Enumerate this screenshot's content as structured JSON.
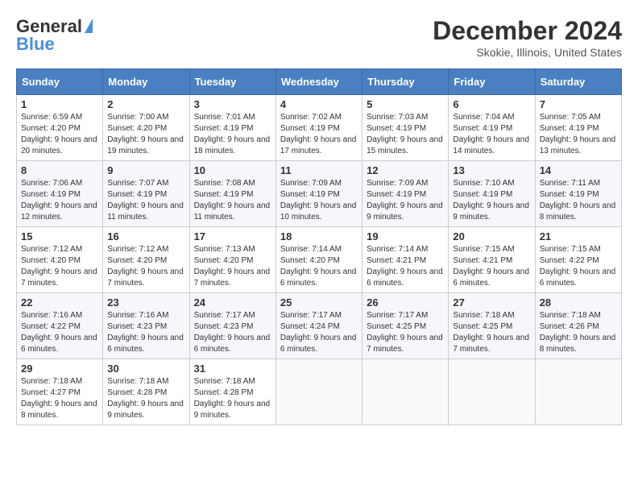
{
  "header": {
    "logo_general": "General",
    "logo_blue": "Blue",
    "month_title": "December 2024",
    "subtitle": "Skokie, Illinois, United States"
  },
  "days_of_week": [
    "Sunday",
    "Monday",
    "Tuesday",
    "Wednesday",
    "Thursday",
    "Friday",
    "Saturday"
  ],
  "weeks": [
    [
      {
        "day": "1",
        "sunrise": "6:59 AM",
        "sunset": "4:20 PM",
        "daylight": "9 hours and 20 minutes."
      },
      {
        "day": "2",
        "sunrise": "7:00 AM",
        "sunset": "4:20 PM",
        "daylight": "9 hours and 19 minutes."
      },
      {
        "day": "3",
        "sunrise": "7:01 AM",
        "sunset": "4:19 PM",
        "daylight": "9 hours and 18 minutes."
      },
      {
        "day": "4",
        "sunrise": "7:02 AM",
        "sunset": "4:19 PM",
        "daylight": "9 hours and 17 minutes."
      },
      {
        "day": "5",
        "sunrise": "7:03 AM",
        "sunset": "4:19 PM",
        "daylight": "9 hours and 15 minutes."
      },
      {
        "day": "6",
        "sunrise": "7:04 AM",
        "sunset": "4:19 PM",
        "daylight": "9 hours and 14 minutes."
      },
      {
        "day": "7",
        "sunrise": "7:05 AM",
        "sunset": "4:19 PM",
        "daylight": "9 hours and 13 minutes."
      }
    ],
    [
      {
        "day": "8",
        "sunrise": "7:06 AM",
        "sunset": "4:19 PM",
        "daylight": "9 hours and 12 minutes."
      },
      {
        "day": "9",
        "sunrise": "7:07 AM",
        "sunset": "4:19 PM",
        "daylight": "9 hours and 11 minutes."
      },
      {
        "day": "10",
        "sunrise": "7:08 AM",
        "sunset": "4:19 PM",
        "daylight": "9 hours and 11 minutes."
      },
      {
        "day": "11",
        "sunrise": "7:09 AM",
        "sunset": "4:19 PM",
        "daylight": "9 hours and 10 minutes."
      },
      {
        "day": "12",
        "sunrise": "7:09 AM",
        "sunset": "4:19 PM",
        "daylight": "9 hours and 9 minutes."
      },
      {
        "day": "13",
        "sunrise": "7:10 AM",
        "sunset": "4:19 PM",
        "daylight": "9 hours and 9 minutes."
      },
      {
        "day": "14",
        "sunrise": "7:11 AM",
        "sunset": "4:19 PM",
        "daylight": "9 hours and 8 minutes."
      }
    ],
    [
      {
        "day": "15",
        "sunrise": "7:12 AM",
        "sunset": "4:20 PM",
        "daylight": "9 hours and 7 minutes."
      },
      {
        "day": "16",
        "sunrise": "7:12 AM",
        "sunset": "4:20 PM",
        "daylight": "9 hours and 7 minutes."
      },
      {
        "day": "17",
        "sunrise": "7:13 AM",
        "sunset": "4:20 PM",
        "daylight": "9 hours and 7 minutes."
      },
      {
        "day": "18",
        "sunrise": "7:14 AM",
        "sunset": "4:20 PM",
        "daylight": "9 hours and 6 minutes."
      },
      {
        "day": "19",
        "sunrise": "7:14 AM",
        "sunset": "4:21 PM",
        "daylight": "9 hours and 6 minutes."
      },
      {
        "day": "20",
        "sunrise": "7:15 AM",
        "sunset": "4:21 PM",
        "daylight": "9 hours and 6 minutes."
      },
      {
        "day": "21",
        "sunrise": "7:15 AM",
        "sunset": "4:22 PM",
        "daylight": "9 hours and 6 minutes."
      }
    ],
    [
      {
        "day": "22",
        "sunrise": "7:16 AM",
        "sunset": "4:22 PM",
        "daylight": "9 hours and 6 minutes."
      },
      {
        "day": "23",
        "sunrise": "7:16 AM",
        "sunset": "4:23 PM",
        "daylight": "9 hours and 6 minutes."
      },
      {
        "day": "24",
        "sunrise": "7:17 AM",
        "sunset": "4:23 PM",
        "daylight": "9 hours and 6 minutes."
      },
      {
        "day": "25",
        "sunrise": "7:17 AM",
        "sunset": "4:24 PM",
        "daylight": "9 hours and 6 minutes."
      },
      {
        "day": "26",
        "sunrise": "7:17 AM",
        "sunset": "4:25 PM",
        "daylight": "9 hours and 7 minutes."
      },
      {
        "day": "27",
        "sunrise": "7:18 AM",
        "sunset": "4:25 PM",
        "daylight": "9 hours and 7 minutes."
      },
      {
        "day": "28",
        "sunrise": "7:18 AM",
        "sunset": "4:26 PM",
        "daylight": "9 hours and 8 minutes."
      }
    ],
    [
      {
        "day": "29",
        "sunrise": "7:18 AM",
        "sunset": "4:27 PM",
        "daylight": "9 hours and 8 minutes."
      },
      {
        "day": "30",
        "sunrise": "7:18 AM",
        "sunset": "4:28 PM",
        "daylight": "9 hours and 9 minutes."
      },
      {
        "day": "31",
        "sunrise": "7:18 AM",
        "sunset": "4:28 PM",
        "daylight": "9 hours and 9 minutes."
      },
      null,
      null,
      null,
      null
    ]
  ]
}
